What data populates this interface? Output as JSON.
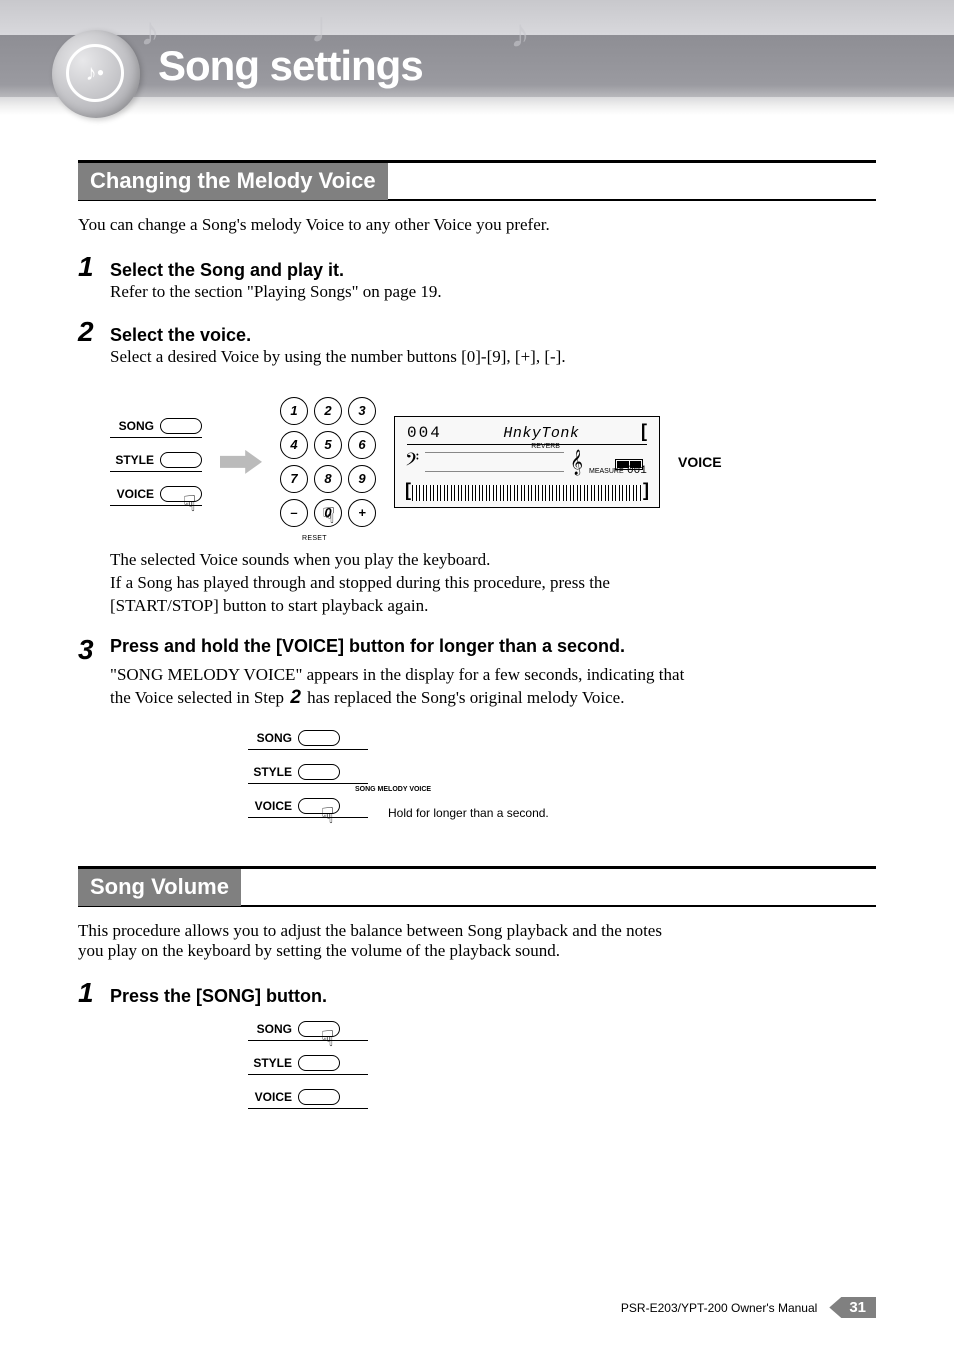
{
  "header": {
    "title": "Song settings"
  },
  "section1": {
    "heading": "Changing the Melody Voice",
    "intro": "You can change a Song's melody Voice to any other Voice you prefer.",
    "steps": [
      {
        "num": "1",
        "title": "Select the Song and play it.",
        "body": "Refer to the section \"Playing Songs\" on page 19."
      },
      {
        "num": "2",
        "title": "Select the voice.",
        "body": "Select a desired Voice by using the number buttons [0]-[9], [+], [-].",
        "after_fig1": "The selected Voice sounds when you play the keyboard.",
        "after_fig2": "If a Song has played through and stopped during this procedure, press the [START/STOP] button to start playback again."
      },
      {
        "num": "3",
        "title": "Press and hold the [VOICE] button for longer than a second.",
        "body_pre": "\"SONG MELODY VOICE\" appears in the display for a few seconds, indicating that the Voice selected in Step ",
        "body_inline_step": "2",
        "body_post": " has replaced the Song's original melody Voice."
      }
    ]
  },
  "figure1": {
    "buttons": {
      "song": "SONG",
      "style": "STYLE",
      "voice": "VOICE"
    },
    "keypad": [
      "1",
      "2",
      "3",
      "4",
      "5",
      "6",
      "7",
      "8",
      "9",
      "–",
      "0",
      "+"
    ],
    "reset": "RESET",
    "lcd": {
      "num": "004",
      "name": "HnkyTonk",
      "reverb": "REVERB",
      "measure_label": "MEASURE",
      "measure_val": "001"
    },
    "voice_label": "VOICE"
  },
  "figure2": {
    "buttons": {
      "song": "SONG",
      "style": "STYLE",
      "voice": "VOICE"
    },
    "smv": "SONG MELODY VOICE",
    "caption": "Hold for longer than a second."
  },
  "section2": {
    "heading": "Song Volume",
    "intro": "This procedure allows you to adjust the balance between Song playback and the notes you play on the keyboard by setting the volume of the playback sound.",
    "steps": [
      {
        "num": "1",
        "title": "Press the [SONG] button."
      }
    ]
  },
  "figure3": {
    "buttons": {
      "song": "SONG",
      "style": "STYLE",
      "voice": "VOICE"
    }
  },
  "footer": {
    "manual": "PSR-E203/YPT-200   Owner's Manual",
    "page": "31"
  }
}
